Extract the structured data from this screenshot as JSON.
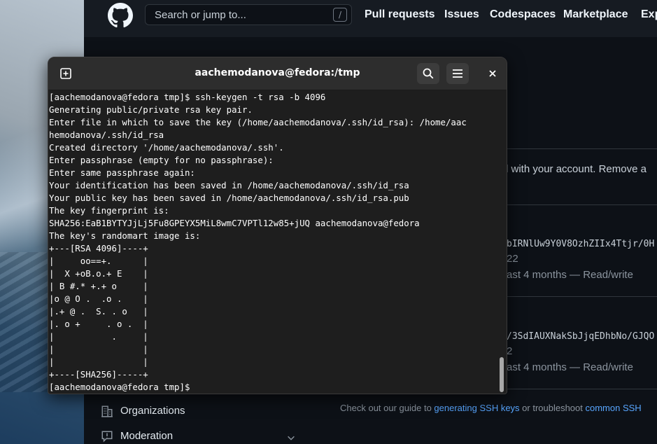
{
  "github": {
    "search_placeholder": "Search or jump to...",
    "search_shortcut": "/",
    "nav": [
      "Pull requests",
      "Issues",
      "Codespaces",
      "Marketplace",
      "Exp"
    ],
    "account_text": "d with your account. Remove a",
    "key1": {
      "fingerprint": "bIRNlUw9Y0V8OzhZIIx4Ttjr/0H",
      "added": "22",
      "usage": "ast 4 months — Read/write"
    },
    "key2": {
      "fingerprint": "/3SdIAUXNakSbJjqEDhbNo/GJQO",
      "added": "2",
      "usage": "ast 4 months — Read/write"
    },
    "sidebar": {
      "organizations": "Organizations",
      "moderation": "Moderation"
    },
    "guide": {
      "prefix": "Check out our guide to ",
      "link1": "generating SSH keys",
      "middle": " or troubleshoot ",
      "link2": "common SSH"
    }
  },
  "terminal": {
    "title": "aachemodanova@fedora:/tmp",
    "lines": [
      "[aachemodanova@fedora tmp]$ ssh-keygen -t rsa -b 4096",
      "Generating public/private rsa key pair.",
      "Enter file in which to save the key (/home/aachemodanova/.ssh/id_rsa): /home/aac",
      "hemodanova/.ssh/id_rsa",
      "Created directory '/home/aachemodanova/.ssh'.",
      "Enter passphrase (empty for no passphrase):",
      "Enter same passphrase again:",
      "Your identification has been saved in /home/aachemodanova/.ssh/id_rsa",
      "Your public key has been saved in /home/aachemodanova/.ssh/id_rsa.pub",
      "The key fingerprint is:",
      "SHA256:EaB1BYTYJjLj5Fu8GPEYX5MiL8wmC7VPTl12w85+jUQ aachemodanova@fedora",
      "The key's randomart image is:",
      "+---[RSA 4096]----+",
      "|     oo==+.      |",
      "|  X +oB.o.+ E    |",
      "| B #.* +.+ o     |",
      "|o @ O .  .o .    |",
      "|.+ @ .  S. . o   |",
      "|. o +     . o .  |",
      "|           .     |",
      "|                 |",
      "|                 |",
      "+----[SHA256]-----+",
      "[aachemodanova@fedora tmp]$ "
    ]
  },
  "colors": {
    "gh_bg": "#0d1117",
    "gh_header": "#161b22",
    "link": "#58a6ff",
    "terminal_bg": "#1e1e1e",
    "titlebar": "#2d2d2d"
  }
}
